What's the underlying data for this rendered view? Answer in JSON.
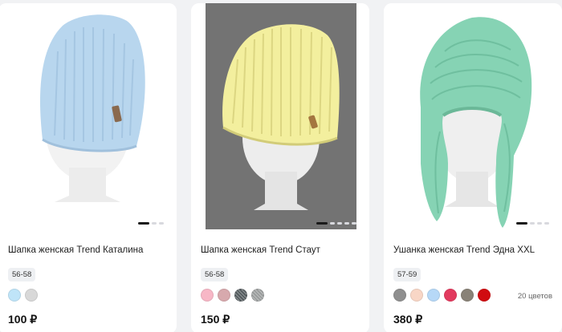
{
  "products": [
    {
      "title": "Шапка женская Trend Каталина",
      "size": "56-58",
      "price": "100 ₽",
      "colors": [
        "#bfe4f8",
        "#d8d8d8"
      ],
      "color_count": "",
      "image_icon": "hat-beanie-blue-icon"
    },
    {
      "title": "Шапка женская Trend Стаут",
      "size": "56-58",
      "price": "150 ₽",
      "colors": [
        "#f7b7c6",
        "#d7a9ad",
        "#555c5f",
        "#9a9d9d"
      ],
      "color_count": "",
      "image_icon": "hat-beanie-yellow-icon"
    },
    {
      "title": "Ушанка женская Trend Эдна XXL",
      "size": "57-59",
      "price": "380 ₽",
      "colors": [
        "#8f8f8f",
        "#f8d6c6",
        "#b6d8f7",
        "#e23a5e",
        "#898277",
        "#d00b10"
      ],
      "color_count": "20 цветов",
      "image_icon": "hat-earflap-green-icon"
    }
  ]
}
